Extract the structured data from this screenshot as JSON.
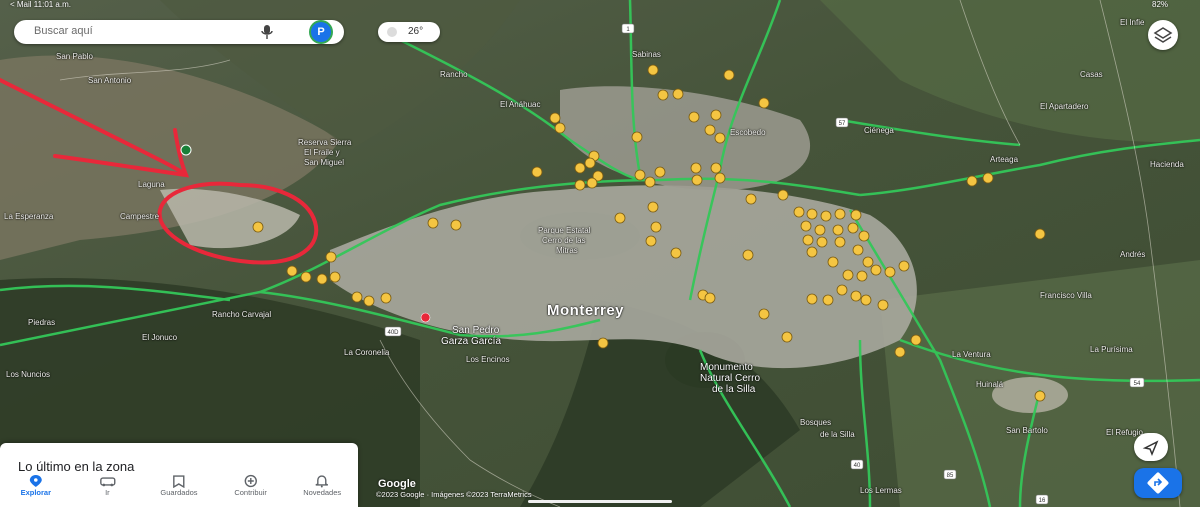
{
  "status_bar": {
    "left": "< Mail   11:01 a.m.",
    "right": "82%"
  },
  "search": {
    "placeholder": "Buscar aquí",
    "avatar_letter": "P"
  },
  "weather": {
    "temp": "26°"
  },
  "map_labels": {
    "monterrey": "Monterrey",
    "san_pedro_1": "San Pedro",
    "san_pedro_2": "Garza García",
    "reserva_1": "Reserva Sierra",
    "reserva_2": "El Fraile y",
    "reserva_3": "San Miguel",
    "chipinque_1": "Parque Estatal",
    "chipinque_2": "Cerro de las",
    "chipinque_3": "Mitras",
    "monumento_1": "Monumento",
    "monumento_2": "Natural Cerro",
    "monumento_3": "de la Silla",
    "el_jonuco": "El Jonuco",
    "los_nuncios": "Los Nuncios",
    "la_coronelia": "La Coronelia",
    "los_encinos": "Los Encinos",
    "rancho_carvajal": "Rancho Carvajal",
    "francisco_villa": "Francisco Villa",
    "el_refugio": "El Refugio",
    "el_apartadero": "El Apartadero",
    "andres": "Andrés",
    "la_ventura": "La Ventura",
    "campestre": "Campestre",
    "laguna": "Laguna",
    "anahuac": "El Anáhuac",
    "huinala": "Huinalá",
    "el_infiernillo": "El Infie",
    "sabinas": "Sabinas",
    "escobedo": "Escobedo",
    "arteaga": "Arteaga",
    "hacienda": "Hacienda",
    "san_antonio": "San Antonio",
    "san_pablo": "San Pablo",
    "piedras": "Piedras",
    "rancho": "Rancho",
    "la_esperanza": "La Esperanza",
    "bosques": "Bosques",
    "san_bartolo": "San Bartolo",
    "cerro_silla_2": "de la Silla",
    "la_purisima": "La Purísima",
    "los_lermas": "Los Lermas",
    "casas": "Casas",
    "cienega": "Ciénega"
  },
  "highway_shields": [
    "1",
    "57",
    "40D",
    "40",
    "85",
    "54",
    "16",
    "30",
    "40D",
    "45"
  ],
  "sheet": {
    "title": "Lo último en la zona",
    "tabs": [
      {
        "label": "Explorar",
        "icon": "location-pin-icon"
      },
      {
        "label": "Ir",
        "icon": "car-icon"
      },
      {
        "label": "Guardados",
        "icon": "bookmark-icon"
      },
      {
        "label": "Contribuir",
        "icon": "add-circle-icon"
      },
      {
        "label": "Novedades",
        "icon": "bell-icon"
      }
    ]
  },
  "attribution": {
    "logo": "Google",
    "text": "©2023 Google · Imágenes ©2023 TerraMetrics"
  },
  "colors": {
    "accent": "#1a73e8",
    "traffic": "#34c759",
    "marker": "#f4c542",
    "annotation": "#e8283a"
  }
}
